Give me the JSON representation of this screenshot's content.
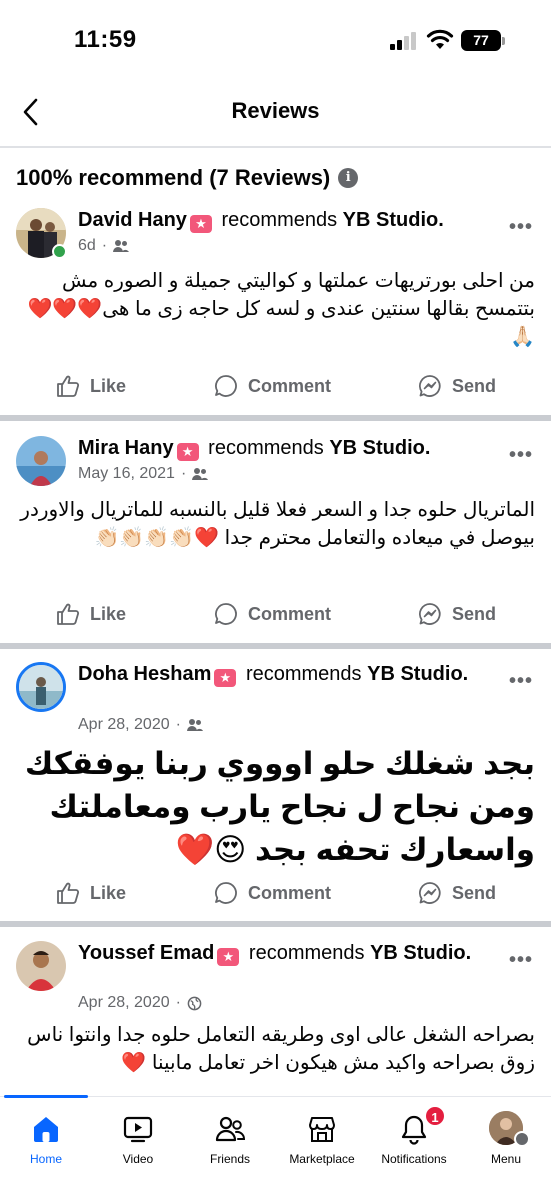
{
  "status": {
    "time": "11:59",
    "battery": "77"
  },
  "header": {
    "title": "Reviews"
  },
  "summary": {
    "text": "100% recommend (7 Reviews)",
    "info_icon": "info-icon"
  },
  "reviews": [
    {
      "author": "David Hany",
      "recommends": "recommends",
      "page": "YB Studio.",
      "time": "6d",
      "audience_icon": "friends-icon",
      "text": "من احلى بورتريهات عملتها و كواليتي جميلة و الصوره مش بتتمسح بقالها سنتين عندى و لسه كل حاجه زى ما هى❤️❤️❤️🙏🏻",
      "online": true
    },
    {
      "author": "Mira Hany",
      "recommends": "recommends",
      "page": "YB Studio.",
      "time": "May 16, 2021",
      "audience_icon": "friends-icon",
      "text": "الماتريال حلوه جدا و السعر فعلا قليل بالنسبه للماتريال والاوردر بيوصل في ميعاده والتعامل محترم جدا ❤️👏🏻👏🏻👏🏻👏🏻"
    },
    {
      "author": "Doha Hesham",
      "recommends": "recommends",
      "page": "YB Studio.",
      "time": "Apr 28, 2020",
      "audience_icon": "friends-icon",
      "text": "بجد شغلك حلو اوووي ربنا يوفقكك ومن نجاح ل نجاح يارب ومعاملتك واسعارك تحفه بجد 😍❤️"
    },
    {
      "author": "Youssef Emad",
      "recommends": "recommends",
      "page": "YB Studio.",
      "time": "Apr 28, 2020",
      "audience_icon": "globe-icon",
      "text": "بصراحه الشغل عالى اوى وطريقه التعامل حلوه جدا وانتوا ناس زوق بصراحه واكيد مش هيكون اخر تعامل مابينا ❤️"
    }
  ],
  "actions": {
    "like": "Like",
    "comment": "Comment",
    "send": "Send"
  },
  "tabs": [
    {
      "label": "Home",
      "icon": "home-icon",
      "active": true
    },
    {
      "label": "Video",
      "icon": "video-icon"
    },
    {
      "label": "Friends",
      "icon": "friends-icon"
    },
    {
      "label": "Marketplace",
      "icon": "marketplace-icon"
    },
    {
      "label": "Notifications",
      "icon": "bell-icon",
      "badge": "1"
    },
    {
      "label": "Menu",
      "icon": "menu-avatar"
    }
  ],
  "colors": {
    "accent": "#0866ff",
    "badge_pink": "#f2577a",
    "muted": "#65676b",
    "notification": "#e41e3f"
  }
}
